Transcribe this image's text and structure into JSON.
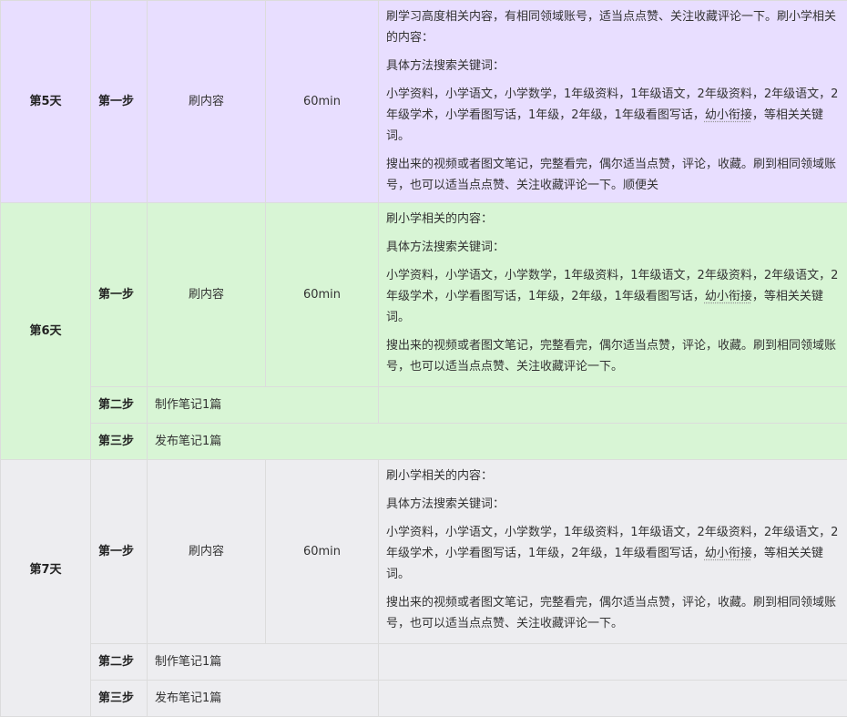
{
  "rows": {
    "day5": {
      "day": "第5天",
      "step": "第一步",
      "action": "刷内容",
      "duration": "60min",
      "p1": "刷学习高度相关内容，有相同领域账号，适当点点赞、关注收藏评论一下。刷小学相关的内容：",
      "p2": "具体方法搜索关键词：",
      "p3a": "小学资料，小学语文，小学数学，1年级资料，1年级语文，2年级资料，2年级语文，2年级学术，小学看图写话，1年级，2年级，1年级看图写话，",
      "p3b": "幼小衔接",
      "p3c": "，等相关关键词。",
      "p4": "搜出来的视频或者图文笔记，完整看完，偶尔适当点赞，评论，收藏。刷到相同领域账号，也可以适当点点赞、关注收藏评论一下。顺便关"
    },
    "day6": {
      "day": "第6天",
      "step1": "第一步",
      "action1": "刷内容",
      "duration1": "60min",
      "p1": "刷小学相关的内容：",
      "p2": "具体方法搜索关键词：",
      "p3a": "小学资料，小学语文，小学数学，1年级资料，1年级语文，2年级资料，2年级语文，2年级学术，小学看图写话，1年级，2年级，1年级看图写话，",
      "p3b": "幼小衔接",
      "p3c": "，等相关关键词。",
      "p4": "搜出来的视频或者图文笔记，完整看完，偶尔适当点赞，评论，收藏。刷到相同领域账号，也可以适当点点赞、关注收藏评论一下。",
      "step2": "第二步",
      "action2": "制作笔记1篇",
      "step3": "第三步",
      "action3": "发布笔记1篇"
    },
    "day7": {
      "day": "第7天",
      "step1": "第一步",
      "action1": "刷内容",
      "duration1": "60min",
      "p1": "刷小学相关的内容：",
      "p2": "具体方法搜索关键词：",
      "p3a": "小学资料，小学语文，小学数学，1年级资料，1年级语文，2年级资料，2年级语文，2年级学术，小学看图写话，1年级，2年级，1年级看图写话，",
      "p3b": "幼小衔接",
      "p3c": "，等相关关键词。",
      "p4": "搜出来的视频或者图文笔记，完整看完，偶尔适当点赞，评论，收藏。刷到相同领域账号，也可以适当点点赞、关注收藏评论一下。",
      "step2": "第二步",
      "action2": "制作笔记1篇",
      "step3": "第三步",
      "action3": "发布笔记1篇"
    }
  }
}
